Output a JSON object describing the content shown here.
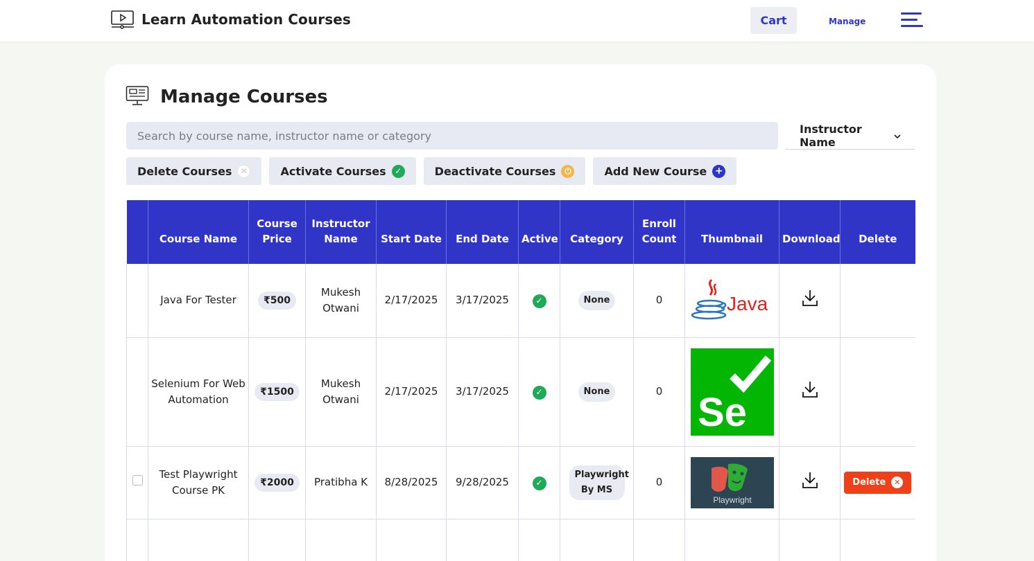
{
  "header": {
    "brand": "Learn Automation Courses",
    "cart": "Cart",
    "manage": "Manage"
  },
  "page": {
    "title": "Manage Courses",
    "search_placeholder": "Search by course name, instructor name or category",
    "instructor_filter": "Instructor Name"
  },
  "actions": {
    "delete": "Delete Courses",
    "activate": "Activate Courses",
    "deactivate": "Deactivate Courses",
    "add": "Add New Course"
  },
  "table": {
    "headers": {
      "course_name": "Course Name",
      "course_price": "Course Price",
      "instructor_name": "Instructor Name",
      "start_date": "Start Date",
      "end_date": "End Date",
      "active": "Active",
      "category": "Category",
      "enroll_count": "Enroll Count",
      "thumbnail": "Thumbnail",
      "download": "Download",
      "delete": "Delete"
    },
    "rows": [
      {
        "course_name": "Java For Tester",
        "price": "₹500",
        "instructor": "Mukesh Otwani",
        "start_date": "2/17/2025",
        "end_date": "3/17/2025",
        "category": "None",
        "enroll_count": "0",
        "thumbnail_text": "Java"
      },
      {
        "course_name": "Selenium For Web Automation",
        "price": "₹1500",
        "instructor": "Mukesh Otwani",
        "start_date": "2/17/2025",
        "end_date": "3/17/2025",
        "category": "None",
        "enroll_count": "0",
        "thumbnail_text": "Se"
      },
      {
        "course_name": "Test Playwright Course PK",
        "price": "₹2000",
        "instructor": "Pratibha K",
        "start_date": "8/28/2025",
        "end_date": "9/28/2025",
        "category": "Playwright By MS",
        "enroll_count": "0",
        "thumbnail_text": "Playwright",
        "delete_label": "Delete"
      }
    ]
  },
  "colors": {
    "primary": "#3035c8",
    "success": "#1eaa57",
    "warning": "#f7b545",
    "danger": "#f0401a"
  }
}
